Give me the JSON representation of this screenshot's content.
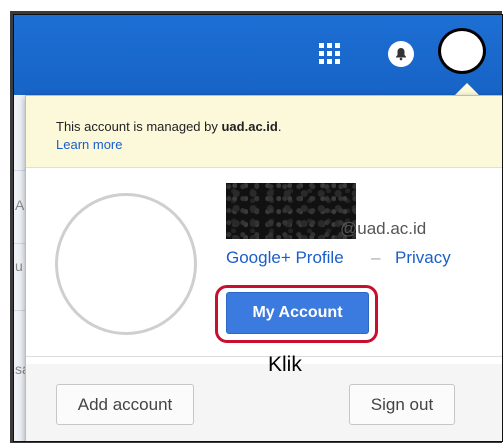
{
  "notice": {
    "managed_prefix": "This account is managed by ",
    "managed_domain": "uad.ac.id",
    "managed_suffix": ".",
    "learn_more": "Learn more"
  },
  "account": {
    "email_domain": "@uad.ac.id",
    "google_plus_profile": "Google+ Profile",
    "separator": "–",
    "privacy": "Privacy",
    "my_account_button": "My Account"
  },
  "annotation": {
    "klik": "Klik"
  },
  "footer": {
    "add_account": "Add account",
    "sign_out": "Sign out"
  },
  "background": {
    "side_chars": [
      "A",
      "u",
      "sa"
    ]
  },
  "colors": {
    "topbar": "#1d6fd4",
    "primary_button": "#3b7be0",
    "link": "#1a5fc9",
    "notice_bg": "#fcf8da",
    "highlight_ring": "#c8102e"
  },
  "icons": {
    "apps": "apps-grid-icon",
    "notifications": "bell-icon",
    "profile": "avatar-icon"
  }
}
